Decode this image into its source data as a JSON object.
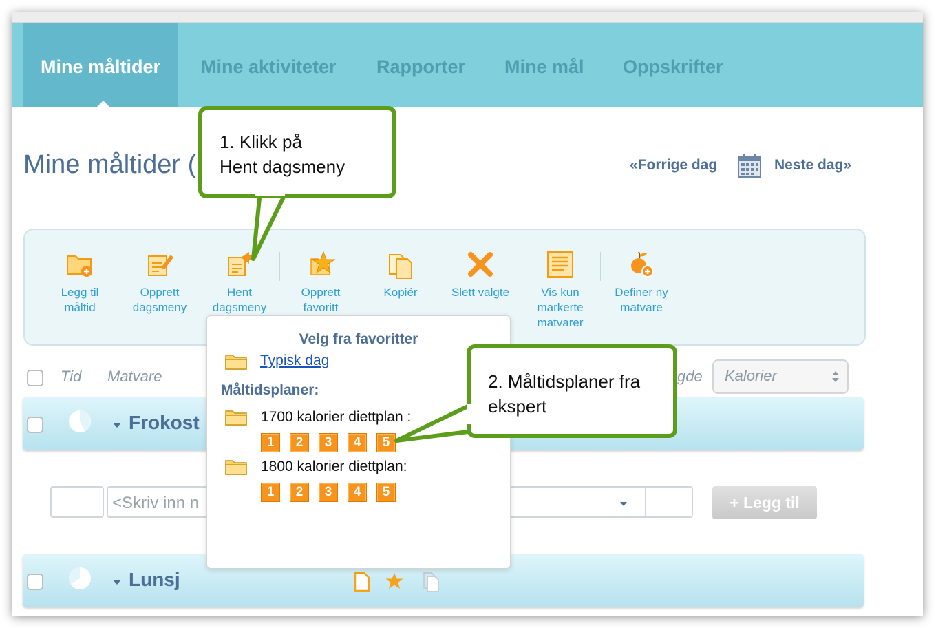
{
  "nav": {
    "tabs": [
      {
        "label": "Mine måltider",
        "active": true
      },
      {
        "label": "Mine aktiviteter"
      },
      {
        "label": "Rapporter"
      },
      {
        "label": "Mine mål"
      },
      {
        "label": "Oppskrifter"
      }
    ]
  },
  "page": {
    "title": "Mine måltider (",
    "prev_day": "«Forrige dag",
    "next_day": "Neste dag»"
  },
  "toolbar": {
    "items": [
      {
        "label_lines": [
          "Legg til",
          "måltid"
        ],
        "icon": "folder-add-icon"
      },
      {
        "label_lines": [
          "Opprett",
          "dagsmeny"
        ],
        "icon": "edit-menu-icon"
      },
      {
        "label_lines": [
          "Hent",
          "dagsmeny"
        ],
        "icon": "fetch-menu-icon"
      },
      {
        "label_lines": [
          "Opprett",
          "favoritt"
        ],
        "icon": "favorite-star-icon"
      },
      {
        "label_lines": [
          "Kopiér"
        ],
        "icon": "copy-icon"
      },
      {
        "label_lines": [
          "Slett valgte"
        ],
        "icon": "delete-x-icon"
      },
      {
        "label_lines": [
          "Vis kun",
          "markerte",
          "matvarer"
        ],
        "icon": "list-icon"
      },
      {
        "label_lines": [
          "Definer ny",
          "matvare"
        ],
        "icon": "new-food-icon"
      }
    ]
  },
  "table_header": {
    "time": "Tid",
    "food": "Matvare",
    "amount_fragment": "gde",
    "unit_select": "Kalorier"
  },
  "meals": [
    {
      "name": "Frokost"
    },
    {
      "name": "Lunsj"
    }
  ],
  "entry": {
    "food_placeholder": "<Skriv inn n",
    "add_button": "+ Legg til"
  },
  "dropdown": {
    "title": "Velg fra favoritter",
    "favorite": "Typisk dag",
    "plans_label": "Måltidsplaner:",
    "plans": [
      {
        "label": "1700 kalorier diettplan :",
        "days": [
          "1",
          "2",
          "3",
          "4",
          "5"
        ]
      },
      {
        "label": "1800 kalorier diettplan:",
        "days": [
          "1",
          "2",
          "3",
          "4",
          "5"
        ]
      }
    ]
  },
  "callouts": {
    "first": [
      "1. Klikk på",
      "Hent dagsmeny"
    ],
    "second": [
      "2. Måltidsplaner fra",
      "ekspert"
    ]
  },
  "colors": {
    "nav_bg": "#7fcfdc",
    "nav_active": "#63b8cb",
    "accent_blue": "#2f9fd8",
    "callout_green": "#5c9e1c",
    "plan_orange": "#f7941d"
  }
}
